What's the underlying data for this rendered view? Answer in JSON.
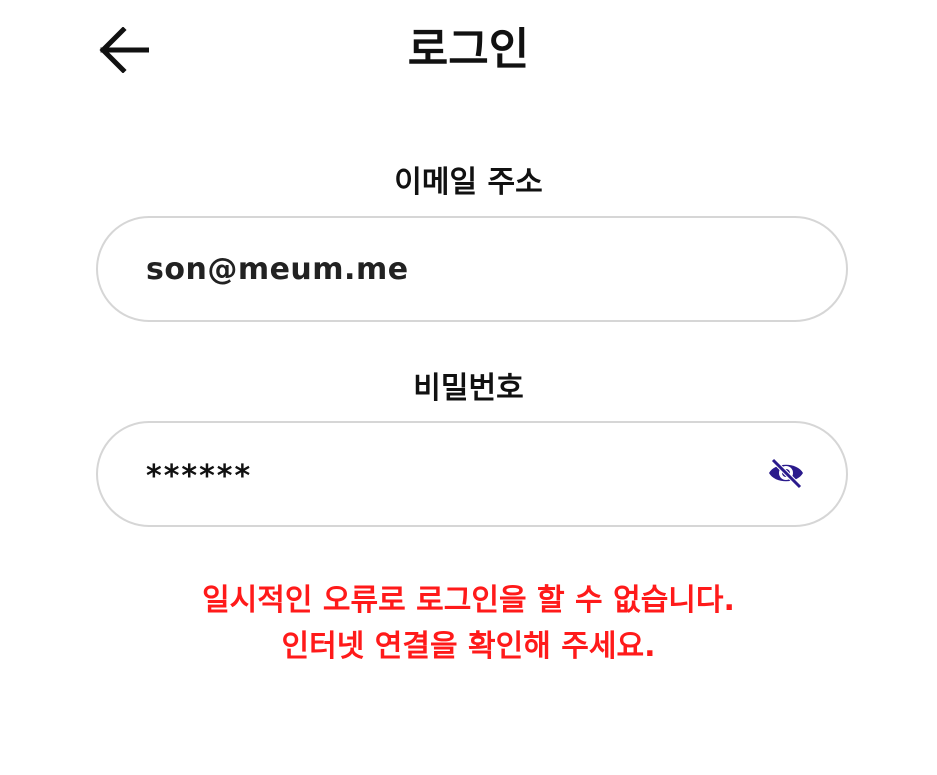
{
  "header": {
    "title": "로그인",
    "back_icon": "arrow-left-icon"
  },
  "form": {
    "email": {
      "label": "이메일 주소",
      "value": "son@meum.me"
    },
    "password": {
      "label": "비밀번호",
      "value": "******",
      "toggle_icon": "eye-off-icon"
    }
  },
  "error": {
    "line1": "일시적인 오류로 로그인을 할 수 없습니다.",
    "line2": "인터넷 연결을 확인해 주세요."
  },
  "colors": {
    "error": "#ff1a1a",
    "icon_accent": "#2a1a8c",
    "input_border": "#d6d6d6"
  }
}
